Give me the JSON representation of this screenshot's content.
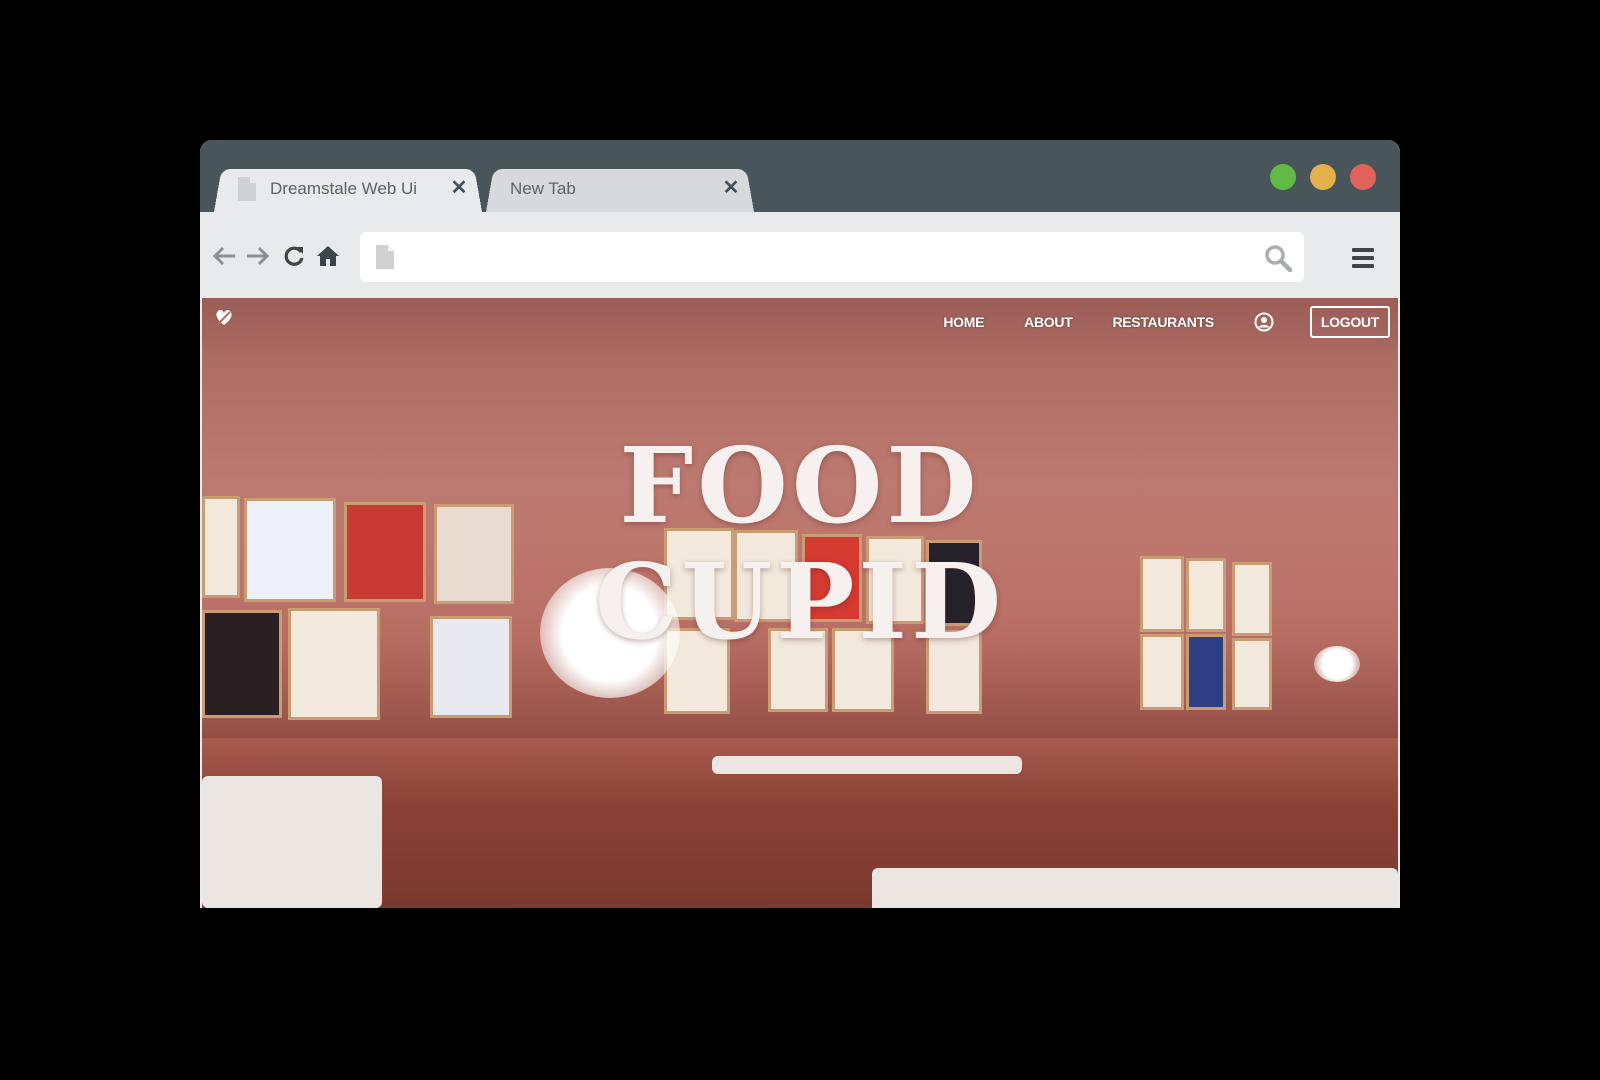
{
  "browser": {
    "tabs": [
      {
        "title": "Dreamstale Web Ui",
        "active": true
      },
      {
        "title": "New Tab",
        "active": false
      }
    ],
    "address_bar": {
      "value": "",
      "placeholder": ""
    },
    "traffic_lights": {
      "green": "#62ba46",
      "yellow": "#e4b04a",
      "red": "#e0625b"
    }
  },
  "site": {
    "nav": {
      "home": "HOME",
      "about": "ABOUT",
      "restaurants": "RESTAURANTS",
      "logout": "LOGOUT"
    },
    "hero": {
      "line1": "FOOD",
      "line2": "CUPID"
    }
  }
}
